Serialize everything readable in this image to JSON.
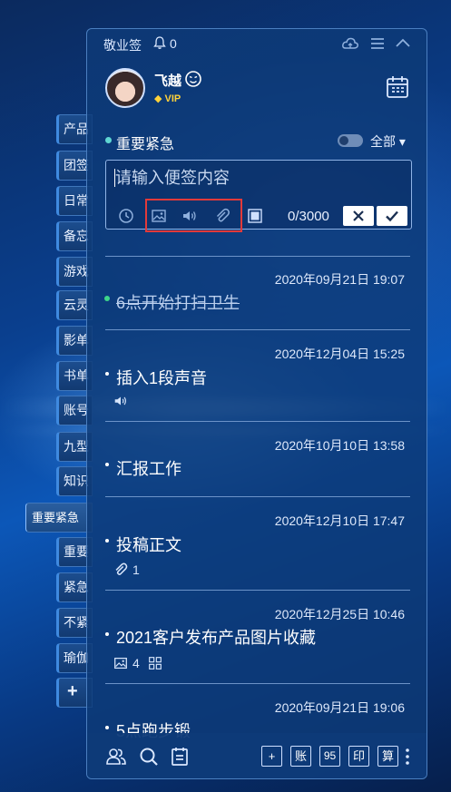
{
  "side_tabs": [
    {
      "label": "产品"
    },
    {
      "label": "团签"
    },
    {
      "label": "日常"
    },
    {
      "label": "备忘"
    },
    {
      "label": "游戏"
    },
    {
      "label": "云灵"
    },
    {
      "label": "影单"
    },
    {
      "label": "书单"
    },
    {
      "label": "账号"
    },
    {
      "label": "九型"
    },
    {
      "label": "知识"
    },
    {
      "label": "重要紧急"
    },
    {
      "label": "重要"
    },
    {
      "label": "紧急"
    },
    {
      "label": "不紧"
    },
    {
      "label": "瑜伽"
    },
    {
      "label": "+"
    }
  ],
  "titlebar": {
    "app_name": "敬业签",
    "notification_count": "0",
    "icons": [
      "cloud-sync-icon",
      "menu-icon",
      "collapse-icon"
    ]
  },
  "user": {
    "name": "飞越",
    "badge": "VIP",
    "icons": [
      "smiley-icon",
      "calendar-icon"
    ]
  },
  "category": {
    "name": "重要紧急",
    "filter": "全部"
  },
  "editor": {
    "placeholder": "请输入便签内容",
    "value": "",
    "counter": "0/3000",
    "tools": [
      "clock-icon",
      "image-icon",
      "sound-icon",
      "attachment-icon",
      "color-icon"
    ]
  },
  "notes": [
    {
      "date": "2020年09月21日 19:07",
      "title": "6点开始打扫卫生",
      "done": true
    },
    {
      "date": "2020年12月04日 15:25",
      "title": "插入1段声音",
      "done": false,
      "meta_icon": "sound-icon"
    },
    {
      "date": "2020年10月10日 13:58",
      "title": "汇报工作",
      "done": false
    },
    {
      "date": "2020年12月10日 17:47",
      "title": "投稿正文",
      "done": false,
      "meta_icon": "attachment-icon",
      "meta_count": "1"
    },
    {
      "date": "2020年12月25日 10:46",
      "title": "2021客户发布产品图片收藏",
      "done": false,
      "meta_icon": "image-icon",
      "meta_count": "4"
    },
    {
      "date": "2020年09月21日 19:06",
      "title": "5点跑步锻",
      "done": false
    }
  ],
  "bottom_bar": {
    "icons": [
      "users-icon",
      "search-icon",
      "list-icon"
    ],
    "buttons": [
      "+",
      "账",
      "95",
      "印",
      "算"
    ]
  }
}
